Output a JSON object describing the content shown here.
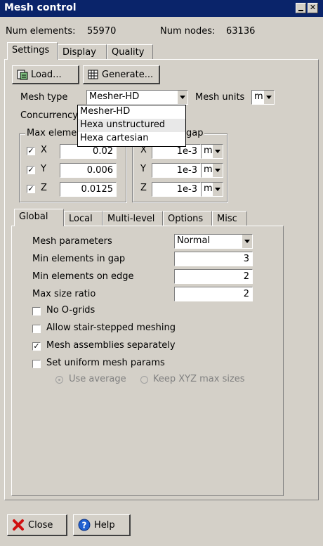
{
  "window": {
    "title": "Mesh control"
  },
  "stats": {
    "num_elements_label": "Num elements:",
    "num_elements": "55970",
    "num_nodes_label": "Num nodes:",
    "num_nodes": "63136"
  },
  "top_tabs": [
    "Settings",
    "Display",
    "Quality"
  ],
  "toolbar": {
    "load_label": "Load...",
    "generate_label": "Generate..."
  },
  "mesh_type": {
    "label": "Mesh type",
    "value": "Mesher-HD",
    "options": [
      "Mesher-HD",
      "Hexa unstructured",
      "Hexa cartesian"
    ]
  },
  "mesh_units": {
    "label": "Mesh units",
    "value": "m"
  },
  "concurrency_label": "Concurrency",
  "max_element": {
    "legend": "Max eleme",
    "rows": [
      {
        "axis": "X",
        "value": "0.02",
        "checked": true
      },
      {
        "axis": "Y",
        "value": "0.006",
        "checked": true
      },
      {
        "axis": "Z",
        "value": "0.0125",
        "checked": true
      }
    ]
  },
  "min_gap": {
    "legend": "gap",
    "rows": [
      {
        "axis": "X",
        "value": "1e-3",
        "unit": "m"
      },
      {
        "axis": "Y",
        "value": "1e-3",
        "unit": "m"
      },
      {
        "axis": "Z",
        "value": "1e-3",
        "unit": "m"
      }
    ]
  },
  "sub_tabs": [
    "Global",
    "Local",
    "Multi-level",
    "Options",
    "Misc"
  ],
  "global": {
    "mesh_parameters_label": "Mesh parameters",
    "mesh_parameters_value": "Normal",
    "min_gap_label": "Min elements in gap",
    "min_gap_value": "3",
    "min_edge_label": "Min elements on edge",
    "min_edge_value": "2",
    "max_ratio_label": "Max size ratio",
    "max_ratio_value": "2",
    "checks": [
      {
        "label": "No O-grids",
        "checked": false
      },
      {
        "label": "Allow stair-stepped meshing",
        "checked": false
      },
      {
        "label": "Mesh assemblies separately",
        "checked": true
      },
      {
        "label": "Set uniform mesh params",
        "checked": false
      }
    ],
    "use_average_label": "Use average",
    "keep_xyz_label": "Keep XYZ max sizes"
  },
  "footer": {
    "close_label": "Close",
    "help_label": "Help"
  }
}
